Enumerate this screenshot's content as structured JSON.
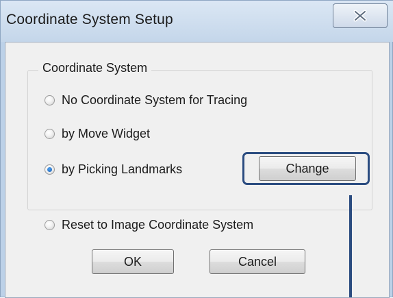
{
  "window": {
    "title": "Coordinate System Setup",
    "close_icon": "close-x-icon"
  },
  "group": {
    "label": "Coordinate System"
  },
  "options": [
    {
      "label": "No Coordinate System for Tracing",
      "checked": false
    },
    {
      "label": "by Move Widget",
      "checked": false
    },
    {
      "label": "by Picking Landmarks",
      "checked": true
    }
  ],
  "change_button": {
    "label": "Change"
  },
  "reset_option": {
    "label": "Reset to Image Coordinate System",
    "checked": false
  },
  "buttons": {
    "ok": "OK",
    "cancel": "Cancel"
  },
  "annotation": {
    "color": "#2b4c80"
  }
}
